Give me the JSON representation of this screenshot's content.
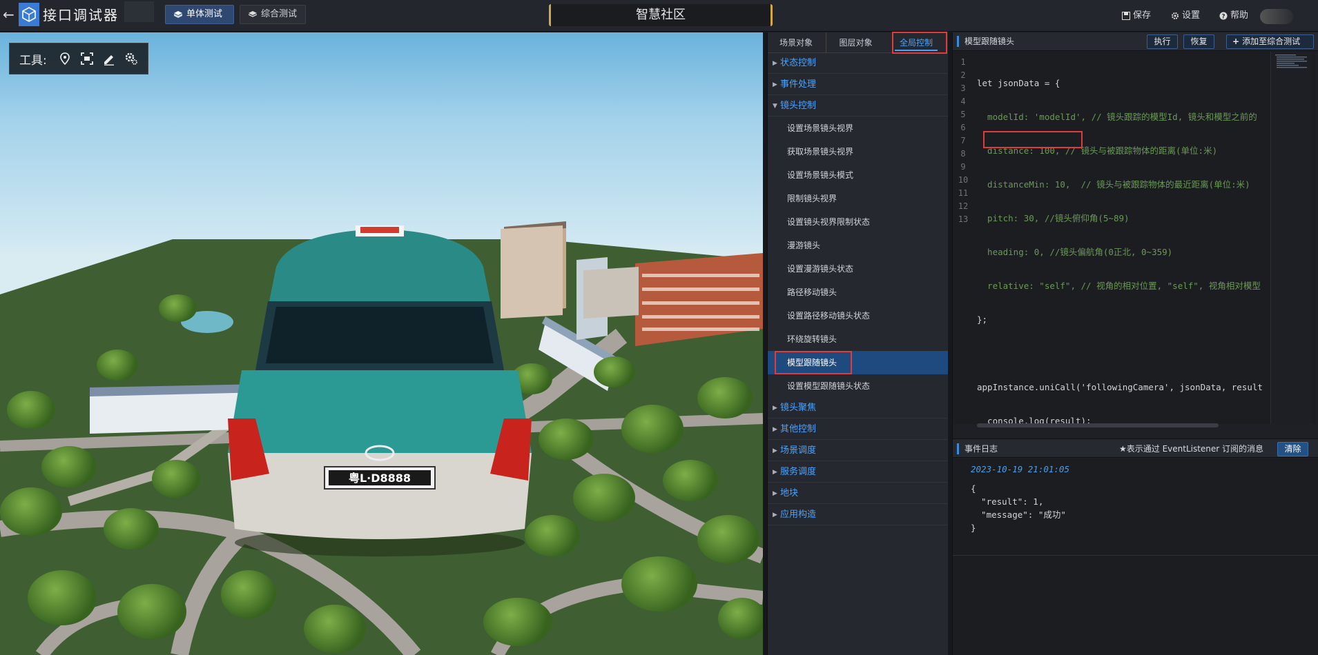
{
  "app": {
    "title": "接口调试器",
    "modes": {
      "single": "单体测试",
      "combo": "综合测试"
    },
    "project_title": "智慧社区",
    "actions": {
      "save": "保存",
      "settings": "设置",
      "help": "帮助"
    }
  },
  "viewport": {
    "tools_label": "工具:",
    "tools": [
      "locate-icon",
      "frame-icon",
      "pen-icon",
      "gear-icon"
    ],
    "plate": "粤L·D8888"
  },
  "tree": {
    "tabs": {
      "scene": "场景对象",
      "layer": "图层对象",
      "global": "全局控制"
    },
    "groups": [
      "状态控制",
      "事件处理",
      "镜头控制",
      "镜头聚焦",
      "其他控制",
      "场景调度",
      "服务调度",
      "地块",
      "应用构造"
    ],
    "camera_items": [
      "设置场景镜头视界",
      "获取场景镜头视界",
      "设置场景镜头模式",
      "限制镜头视界",
      "设置镜头视界限制状态",
      "漫游镜头",
      "设置漫游镜头状态",
      "路径移动镜头",
      "设置路径移动镜头状态",
      "环绕旋转镜头",
      "模型跟随镜头",
      "设置模型跟随镜头状态"
    ],
    "active_item": "模型跟随镜头"
  },
  "code_panel": {
    "title": "模型跟随镜头",
    "run": "执行",
    "reset": "恢复",
    "add": "添加至综合测试",
    "line_numbers": [
      "1",
      "2",
      "3",
      "4",
      "5",
      "6",
      "7",
      "8",
      "9",
      "10",
      "11",
      "12",
      "13"
    ],
    "lines": [
      "let jsonData = {",
      "  modelId: 'modelId', // 镜头跟踪的模型Id, 镜头和模型之前的",
      "  distance: 100, // 镜头与被跟踪物体的距离(单位:米)",
      "  distanceMin: 10,  // 镜头与被跟踪物体的最近距离(单位:米)",
      "  pitch: 30, //镜头俯仰角(5~89)",
      "  heading: 0, //镜头偏航角(0正北, 0~359)",
      "  relative: \"self\", // 视角的相对位置, \"self\", 视角相对模型",
      "};",
      "",
      "appInstance.uniCall('followingCamera', jsonData, result",
      "  console.log(result);",
      "});",
      ""
    ]
  },
  "log_panel": {
    "title": "事件日志",
    "note": "★表示通过 EventListener 订阅的消息",
    "clear": "清除",
    "timestamp": "2023-10-19 21:01:05",
    "json": "{\n  \"result\": 1,\n  \"message\": \"成功\"\n}"
  },
  "colors": {
    "accent": "#4aa3ff",
    "active_item_bg": "#1e4a80",
    "highlight_box": "#e23b3b",
    "title_border": "#d4a84a"
  }
}
